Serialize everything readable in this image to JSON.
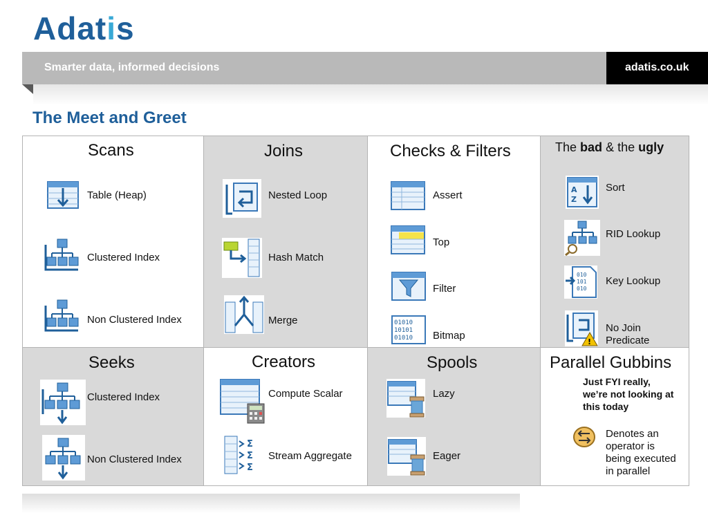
{
  "brand": {
    "logo_main": "Adat",
    "logo_i": "i",
    "logo_end": "s",
    "tagline": "Smarter data, informed decisions",
    "site": "adatis.co.uk"
  },
  "slide_title": "The Meet and Greet",
  "scans": {
    "header": "Scans",
    "items": [
      "Table (Heap)",
      "Clustered Index",
      "Non Clustered Index"
    ]
  },
  "joins": {
    "header": "Joins",
    "items": [
      "Nested Loop",
      "Hash Match",
      "Merge"
    ]
  },
  "checks": {
    "header": "Checks & Filters",
    "items": [
      "Assert",
      "Top",
      "Filter",
      "Bitmap"
    ]
  },
  "bad": {
    "header_the": "The",
    "header_bad": "bad",
    "header_and": "& the",
    "header_ugly": "ugly",
    "items": [
      "Sort",
      "RID Lookup",
      "Key Lookup",
      "No Join",
      "Predicate"
    ]
  },
  "seeks": {
    "header": "Seeks",
    "items": [
      "Clustered Index",
      "Non Clustered Index"
    ]
  },
  "creators": {
    "header": "Creators",
    "items": [
      "Compute Scalar",
      "Stream Aggregate"
    ]
  },
  "spools": {
    "header": "Spools",
    "items": [
      "Lazy",
      "Eager"
    ]
  },
  "parallel": {
    "header": "Parallel Gubbins",
    "note": [
      "Just  FYI really,",
      "we’re not looking at",
      "this today"
    ],
    "desc": [
      "Denotes an",
      "operator is",
      "being executed",
      "in parallel"
    ]
  },
  "icons": [
    "table-scan-icon",
    "clustered-index-scan-icon",
    "nonclustered-index-scan-icon",
    "nested-loop-icon",
    "hash-match-icon",
    "merge-join-icon",
    "assert-icon",
    "top-icon",
    "filter-icon",
    "bitmap-icon",
    "sort-icon",
    "rid-lookup-icon",
    "key-lookup-icon",
    "no-join-predicate-icon",
    "clustered-index-seek-icon",
    "nonclustered-index-seek-icon",
    "compute-scalar-icon",
    "stream-aggregate-icon",
    "lazy-spool-icon",
    "eager-spool-icon",
    "parallelism-icon"
  ],
  "colors": {
    "brand_blue": "#1f5f9a",
    "accent_blue": "#39a9d6",
    "cell_gray": "#d9d9d9",
    "band_gray": "#b9b9b9",
    "warning": "#f2c200"
  }
}
